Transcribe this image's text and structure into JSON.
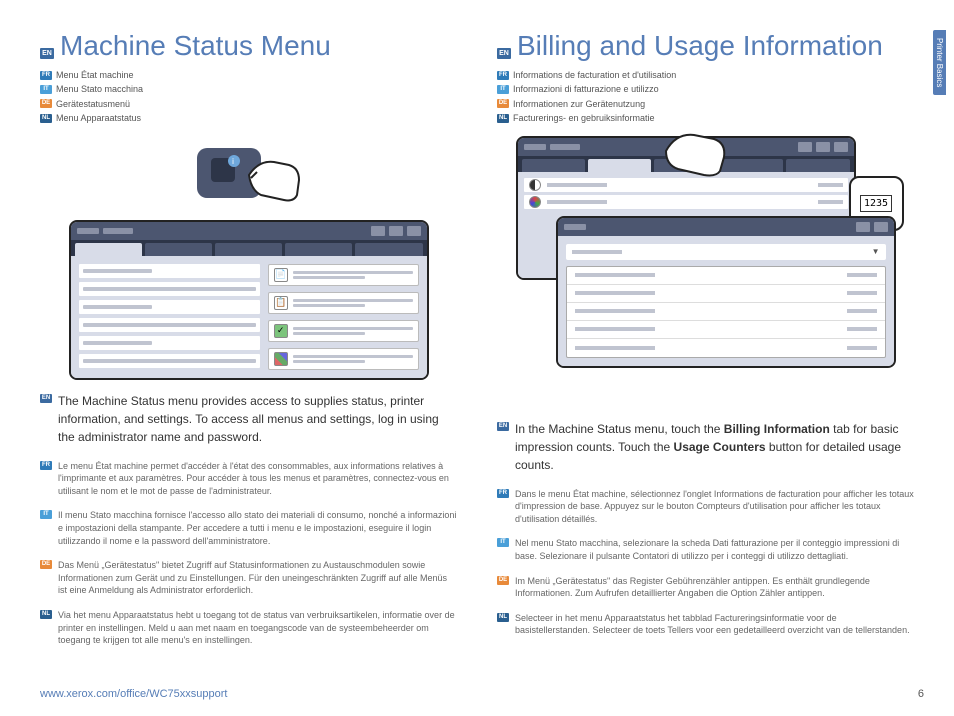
{
  "side_tab": "Printer Basics",
  "footer_url": "www.xerox.com/office/WC75xxsupport",
  "page_number": "6",
  "left": {
    "title": "Machine Status Menu",
    "subtitles": {
      "fr": "Menu État machine",
      "it": "Menu Stato macchina",
      "de": "Gerätestatusmenü",
      "nl": "Menu Apparaatstatus"
    },
    "body_en": "The Machine Status menu provides access to supplies status, printer information, and settings. To access all menus and settings, log in using the administrator name and password.",
    "trans": {
      "fr": "Le menu État machine permet d'accéder à l'état des consommables, aux informations relatives à l'imprimante et aux paramètres. Pour accéder à tous les menus et paramètres, connectez-vous en utilisant le nom et le mot de passe de l'administrateur.",
      "it": "Il menu Stato macchina fornisce l'accesso allo stato dei materiali di consumo, nonché a informazioni e impostazioni della stampante. Per accedere a tutti i menu e le impostazioni, eseguire il login utilizzando il nome e la password dell'amministratore.",
      "de": "Das Menü „Gerätestatus\" bietet Zugriff auf Statusinformationen zu Austauschmodulen sowie Informationen zum Gerät und zu Einstellungen. Für den uneingeschränkten Zugriff auf alle Menüs ist eine Anmeldung als Administrator erforderlich.",
      "nl": "Via het menu Apparaatstatus hebt u toegang tot de status van verbruiksartikelen, informatie over de printer en instellingen. Meld u aan met naam en toegangscode van de systeembeheerder om toegang te krijgen tot alle menu's en instellingen."
    }
  },
  "right": {
    "title": "Billing and Usage Information",
    "subtitles": {
      "fr": "Informations de facturation et d'utilisation",
      "it": "Informazioni di fatturazione e utilizzo",
      "de": "Informationen zur Gerätenutzung",
      "nl": "Facturerings- en gebruiksinformatie"
    },
    "counter": "1235",
    "body_en_pre": "In the Machine Status menu, touch the ",
    "body_en_b1": "Billing Information",
    "body_en_mid": " tab for basic impression counts. Touch the ",
    "body_en_b2": "Usage Counters",
    "body_en_post": " button for detailed usage counts.",
    "trans": {
      "fr": "Dans le menu État machine, sélectionnez l'onglet Informations de facturation pour afficher les totaux d'impression de base. Appuyez sur le bouton Compteurs d'utilisation pour afficher les totaux d'utilisation détaillés.",
      "it": "Nel menu Stato macchina, selezionare la scheda Dati fatturazione per il conteggio impressioni di base. Selezionare il pulsante Contatori di utilizzo per i conteggi di utilizzo dettagliati.",
      "de": "Im Menü „Gerätestatus\" das Register Gebührenzähler antippen. Es enthält grundlegende Informationen. Zum Aufrufen detaillierter Angaben die Option Zähler antippen.",
      "nl": "Selecteer in het menu Apparaatstatus het tabblad Factureringsinformatie voor de basistellerstanden. Selecteer de toets Tellers voor een gedetailleerd overzicht van de tellerstanden."
    }
  }
}
